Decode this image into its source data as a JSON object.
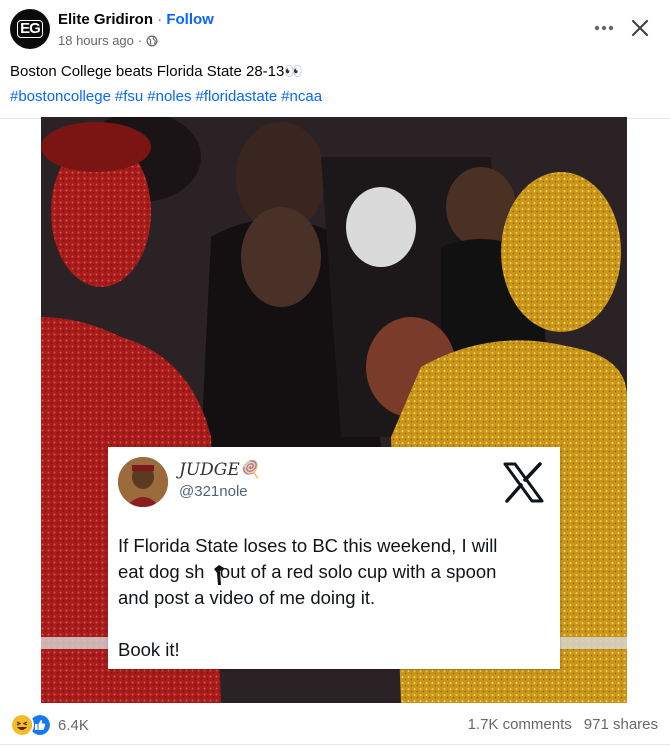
{
  "post": {
    "page_name": "Elite Gridiron",
    "separator": "·",
    "follow_label": "Follow",
    "avatar_initials": "EG",
    "time": "18 hours ago",
    "time_separator": "·",
    "privacy_icon": "globe-icon",
    "caption": "Boston College beats Florida State 28-13👀",
    "hashtags": [
      "#bostoncollege",
      "#fsu",
      "#noles",
      "#floridastate",
      "#ncaa"
    ],
    "menu_icon": "more-horizontal-icon",
    "close_icon": "close-icon"
  },
  "image": {
    "tweet": {
      "display_name": "JUDGE🍭",
      "handle": "@321nole",
      "platform_icon": "x-logo-icon",
      "lines": [
        "If Florida State loses to BC this weekend, I will",
        "eat dog sh   out of a red solo cup with a spoon",
        "and post a video of me doing it."
      ],
      "closing": "Book it!"
    }
  },
  "footer": {
    "reaction_icons": [
      "haha-reaction-icon",
      "like-reaction-icon"
    ],
    "reaction_count": "6.4K",
    "comments": "1.7K comments",
    "shares": "971 shares"
  },
  "colors": {
    "link": "#0866ff",
    "secondary_text": "#65676b",
    "red_glitter": "#b3201e",
    "gold_glitter": "#d4a21c"
  }
}
